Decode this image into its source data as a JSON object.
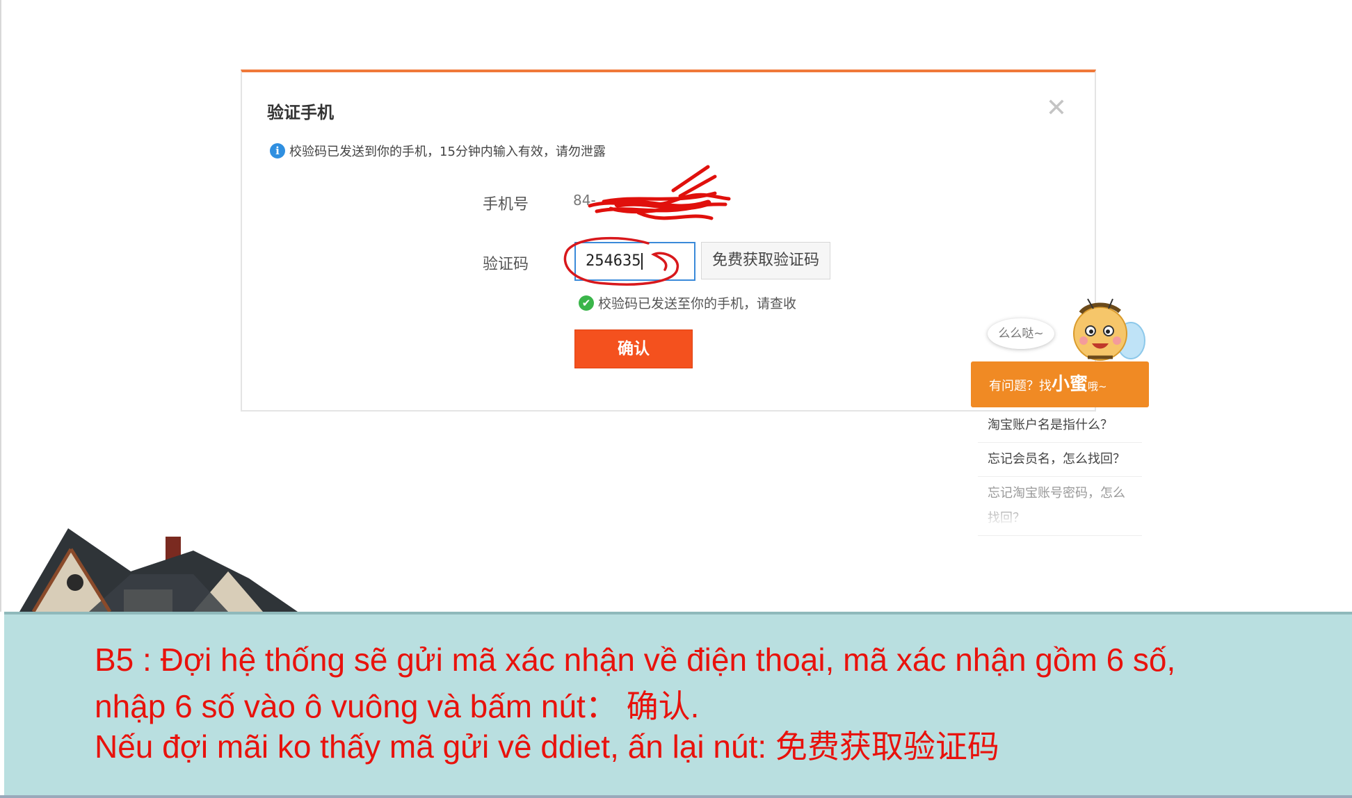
{
  "dialog": {
    "title": "验证手机",
    "notice": "校验码已发送到你的手机，15分钟内输入有效，请勿泄露",
    "phone_label": "手机号",
    "phone_value": "84-",
    "code_label": "验证码",
    "code_value": "254635",
    "get_code_button": "免费获取验证码",
    "sent_message": "校验码已发送至你的手机，请查收",
    "confirm_button": "确认"
  },
  "helper": {
    "bubble_text": "么么哒~",
    "bar_prefix": "有问题？找",
    "bar_name": "小蜜",
    "bar_suffix": "哦~",
    "items": [
      "淘宝账户名是指什么？",
      "忘记会员名，怎么找回？",
      "忘记淘宝账号密码，怎么找回？"
    ]
  },
  "caption": {
    "line1": "B5 : Đợi hệ thống sẽ gửi mã xác nhận về điện thoại, mã xác nhận gồm 6 số,",
    "line2": "nhập 6 số vào ô vuông và bấm nút： 确认.",
    "line3": "Nếu đợi mãi ko thấy mã gửi vê ddiet, ấn lại nút: 免费获取验证码"
  },
  "icons": [
    "info-icon",
    "close-icon",
    "check-icon",
    "bee-mascot-icon",
    "house-image"
  ],
  "colors": {
    "accent_orange": "#f4511e",
    "dialog_top_border": "#f0793a",
    "caption_bg": "#b9dfe0",
    "caption_text": "#e8120c",
    "helper_bar": "#f08a24"
  }
}
